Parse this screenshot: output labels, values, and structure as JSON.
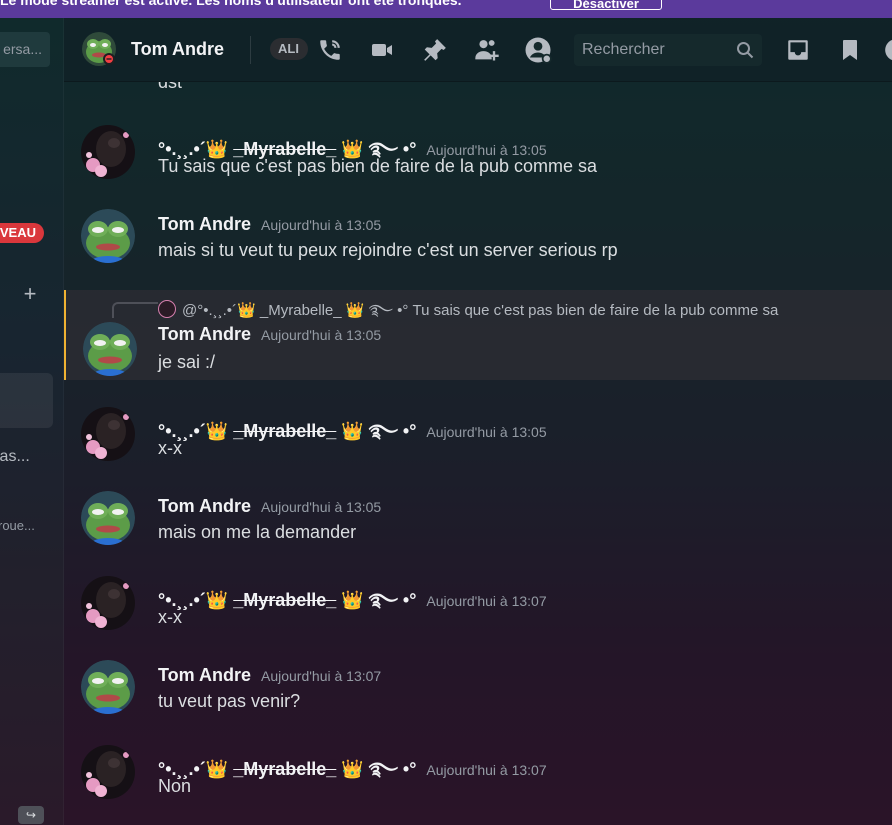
{
  "notice": {
    "text": "Le mode streamer est activé. Les noms d'utilisateur ont été tronqués.",
    "button": "Désactiver"
  },
  "sidebar": {
    "search_label": "ersa...",
    "new_badge": "VEAU",
    "plus": "+",
    "item1": "ias...",
    "item2": "roue..."
  },
  "header": {
    "title": "Tom Andre",
    "pill": "ALI",
    "search_placeholder": "Rechercher",
    "icons": [
      "call-icon",
      "video-icon",
      "pin-icon",
      "add-friend-icon",
      "user-profile-icon",
      "inbox-icon",
      "bookmark-icon",
      "help-icon"
    ]
  },
  "messages": [
    {
      "type": "continuation",
      "content": "dst"
    },
    {
      "author": "Myrabelle",
      "author_prefix": "°•.¸¸.•´",
      "crown": "👑",
      "author_name": "_Myrabelle_",
      "author_suffix": "࿐ •°",
      "timestamp": "Aujourd'hui à 13:05",
      "content": "Tu sais que c'est pas bien de faire de la pub comme sa"
    },
    {
      "author": "Tom",
      "author_name": "Tom Andre",
      "timestamp": "Aujourd'hui à 13:05",
      "content": "mais si tu veut tu peux rejoindre c'est un server serious rp"
    },
    {
      "author": "Tom",
      "author_name": "Tom Andre",
      "timestamp": "Aujourd'hui à 13:05",
      "content": "je sai :/",
      "reply": "@°•.¸¸.•´👑 _Myrabelle_ 👑 ࿐ •° Tu sais que c'est pas bien de faire de la pub comme sa"
    },
    {
      "author": "Myrabelle",
      "author_prefix": "°•.¸¸.•´",
      "crown": "👑",
      "author_name": "_Myrabelle_",
      "author_suffix": "࿐ •°",
      "timestamp": "Aujourd'hui à 13:05",
      "content": "x-x"
    },
    {
      "author": "Tom",
      "author_name": "Tom Andre",
      "timestamp": "Aujourd'hui à 13:05",
      "content": "mais on me la demander"
    },
    {
      "author": "Myrabelle",
      "author_prefix": "°•.¸¸.•´",
      "crown": "👑",
      "author_name": "_Myrabelle_",
      "author_suffix": "࿐ •°",
      "timestamp": "Aujourd'hui à 13:07",
      "content": "x-x"
    },
    {
      "author": "Tom",
      "author_name": "Tom Andre",
      "timestamp": "Aujourd'hui à 13:07",
      "content": "tu veut pas venir?"
    },
    {
      "author": "Myrabelle",
      "author_prefix": "°•.¸¸.•´",
      "crown": "👑",
      "author_name": "_Myrabelle_",
      "author_suffix": "࿐ •°",
      "timestamp": "Aujourd'hui à 13:07",
      "content": "Non"
    }
  ]
}
